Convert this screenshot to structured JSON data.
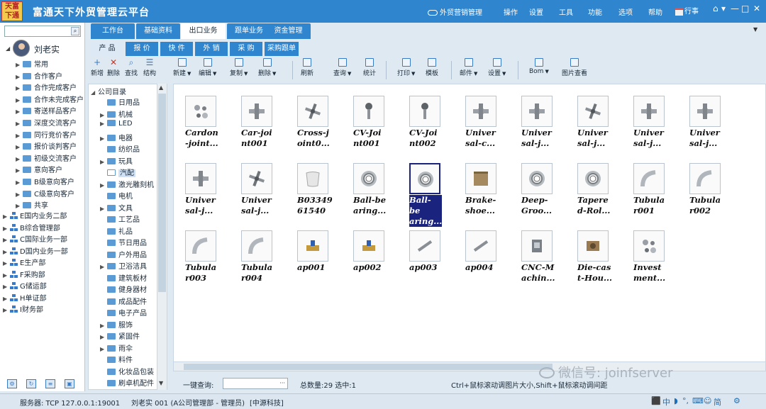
{
  "app": {
    "logo_text": "天富下通",
    "title": "富通天下外贸管理云平台",
    "cloud_menu": "外贸营销管理",
    "menu": [
      "操作",
      "设置",
      "工具",
      "功能",
      "选项",
      "帮助"
    ],
    "event_btn": "行事",
    "window_controls": [
      "⌂",
      "▾",
      "—",
      "□",
      "✕"
    ]
  },
  "user_panel": {
    "search_placeholder": "",
    "user_name": "刘老实",
    "items": [
      {
        "label": "常用",
        "kind": "folder"
      },
      {
        "label": "合作客户",
        "kind": "folder"
      },
      {
        "label": "合作完成客户",
        "kind": "folder"
      },
      {
        "label": "合作未完成客户",
        "kind": "folder"
      },
      {
        "label": "寄送样品客户",
        "kind": "folder"
      },
      {
        "label": "深度交流客户",
        "kind": "folder"
      },
      {
        "label": "同行竞价客户",
        "kind": "folder"
      },
      {
        "label": "报价谈判客户",
        "kind": "folder"
      },
      {
        "label": "初级交流客户",
        "kind": "folder"
      },
      {
        "label": "意向客户",
        "kind": "folder"
      },
      {
        "label": "B级意向客户",
        "kind": "folder"
      },
      {
        "label": "C级意向客户",
        "kind": "folder"
      },
      {
        "label": "共享",
        "kind": "folder"
      }
    ],
    "departments": [
      "E国内业务二部",
      "B综合管理部",
      "C国际业务一部",
      "D国内业务一部",
      "E生产部",
      "F采购部",
      "G储运部",
      "H单证部",
      "I财务部"
    ]
  },
  "main_tabs": [
    {
      "label": "工作台",
      "active": false
    },
    {
      "label": "基础资料",
      "active": false
    },
    {
      "label": "出口业务",
      "active": true
    },
    {
      "label": "跟单业务",
      "active": false
    },
    {
      "label": "资金管理",
      "active": false
    }
  ],
  "sub_tabs": [
    {
      "label": "产 品",
      "active": true
    },
    {
      "label": "报 价",
      "active": false
    },
    {
      "label": "快 件",
      "active": false
    },
    {
      "label": "外 销",
      "active": false
    },
    {
      "label": "采 购",
      "active": false
    },
    {
      "label": "采购跟单",
      "active": false
    }
  ],
  "left_toolbar": [
    {
      "label": "新增",
      "icon": "plus-icon"
    },
    {
      "label": "删除",
      "icon": "x-icon"
    },
    {
      "label": "查找",
      "icon": "find-icon"
    },
    {
      "label": "结构",
      "icon": "structure-icon"
    }
  ],
  "catalog": {
    "root": "公司目录",
    "items": [
      {
        "label": "日用品",
        "expandable": false
      },
      {
        "label": "机械",
        "expandable": true
      },
      {
        "label": "LED",
        "expandable": true
      },
      {
        "label": "电器",
        "expandable": true
      },
      {
        "label": "纺织品",
        "expandable": false
      },
      {
        "label": "玩具",
        "expandable": true
      },
      {
        "label": "汽配",
        "expandable": false,
        "selected": true
      },
      {
        "label": "激光雕刻机",
        "expandable": true
      },
      {
        "label": "电机",
        "expandable": false
      },
      {
        "label": "文具",
        "expandable": true
      },
      {
        "label": "工艺品",
        "expandable": false
      },
      {
        "label": "礼品",
        "expandable": false
      },
      {
        "label": "节日用品",
        "expandable": false
      },
      {
        "label": "户外用品",
        "expandable": false
      },
      {
        "label": "卫浴洁具",
        "expandable": true
      },
      {
        "label": "建筑板材",
        "expandable": false
      },
      {
        "label": "健身器材",
        "expandable": false
      },
      {
        "label": "成品配件",
        "expandable": false
      },
      {
        "label": "电子产品",
        "expandable": false
      },
      {
        "label": "服饰",
        "expandable": true
      },
      {
        "label": "紧固件",
        "expandable": true
      },
      {
        "label": "雨伞",
        "expandable": true
      },
      {
        "label": "料件",
        "expandable": false
      },
      {
        "label": "化妆品包装",
        "expandable": false
      },
      {
        "label": "刷卓机配件",
        "expandable": false
      }
    ]
  },
  "main_toolbar": [
    {
      "label": "新建",
      "dropdown": true
    },
    {
      "label": "编辑",
      "dropdown": true
    },
    {
      "label": "复制",
      "dropdown": true
    },
    {
      "label": "删除",
      "dropdown": true
    },
    {
      "label": "刷新",
      "dropdown": false
    },
    {
      "label": "查询",
      "dropdown": true
    },
    {
      "label": "统计",
      "dropdown": false
    },
    {
      "label": "打印",
      "dropdown": true
    },
    {
      "label": "模板",
      "dropdown": false
    },
    {
      "label": "邮件",
      "dropdown": true
    },
    {
      "label": "设置",
      "dropdown": true
    },
    {
      "label": "Bom",
      "dropdown": true
    },
    {
      "label": "图片查看",
      "dropdown": false
    }
  ],
  "products": [
    {
      "name": [
        "Cardon",
        "-joint..."
      ],
      "icon": "parts-icon",
      "selected": false
    },
    {
      "name": [
        "Car-joi",
        "nt001"
      ],
      "icon": "ujoint-icon",
      "selected": false
    },
    {
      "name": [
        "Cross-j",
        "oint0..."
      ],
      "icon": "cross-icon",
      "selected": false
    },
    {
      "name": [
        "CV-Joi",
        "nt001"
      ],
      "icon": "cvjoint-icon",
      "selected": false
    },
    {
      "name": [
        "CV-Joi",
        "nt002"
      ],
      "icon": "cvjoint-icon",
      "selected": false
    },
    {
      "name": [
        "Univer",
        "sal-c..."
      ],
      "icon": "ujoint-icon",
      "selected": false
    },
    {
      "name": [
        "Univer",
        "sal-j..."
      ],
      "icon": "ujoint-icon",
      "selected": false
    },
    {
      "name": [
        "Univer",
        "sal-j..."
      ],
      "icon": "cross-icon",
      "selected": false
    },
    {
      "name": [
        "Univer",
        "sal-j..."
      ],
      "icon": "ujoint-icon",
      "selected": false
    },
    {
      "name": [
        "Univer",
        "sal-j..."
      ],
      "icon": "ujoint-icon",
      "selected": false
    },
    {
      "name": [
        "Univer",
        "sal-j..."
      ],
      "icon": "ujoint-icon",
      "selected": false
    },
    {
      "name": [
        "Univer",
        "sal-j..."
      ],
      "icon": "cross-icon",
      "selected": false
    },
    {
      "name": [
        "B03349",
        "61540"
      ],
      "icon": "shell-icon",
      "selected": false
    },
    {
      "name": [
        "Ball-be",
        "aring..."
      ],
      "icon": "bearing-icon",
      "selected": false
    },
    {
      "name": [
        "Ball-be",
        "aring..."
      ],
      "icon": "bearing-icon",
      "selected": true
    },
    {
      "name": [
        "Brake-",
        "shoe..."
      ],
      "icon": "brake-icon",
      "selected": false
    },
    {
      "name": [
        "Deep-",
        "Groo..."
      ],
      "icon": "bearing-icon",
      "selected": false
    },
    {
      "name": [
        "Tapere",
        "d-Rol..."
      ],
      "icon": "bearing-icon",
      "selected": false
    },
    {
      "name": [
        "Tubula",
        "r001"
      ],
      "icon": "tube-icon",
      "selected": false
    },
    {
      "name": [
        "Tubula",
        "r002"
      ],
      "icon": "tube-icon",
      "selected": false
    },
    {
      "name": [
        "Tubula",
        "r003"
      ],
      "icon": "tube-icon",
      "selected": false
    },
    {
      "name": [
        "Tubula",
        "r004"
      ],
      "icon": "tube-icon",
      "selected": false
    },
    {
      "name": [
        "ap001"
      ],
      "icon": "valve-icon",
      "selected": false
    },
    {
      "name": [
        "ap002"
      ],
      "icon": "valve-icon",
      "selected": false
    },
    {
      "name": [
        "ap003"
      ],
      "icon": "rod-icon",
      "selected": false
    },
    {
      "name": [
        "ap004"
      ],
      "icon": "rod-icon",
      "selected": false
    },
    {
      "name": [
        "CNC-M",
        "achin..."
      ],
      "icon": "cnc-icon",
      "selected": false
    },
    {
      "name": [
        "Die-cas",
        "t-Hou..."
      ],
      "icon": "housing-icon",
      "selected": false
    },
    {
      "name": [
        "Invest",
        "ment..."
      ],
      "icon": "parts-icon",
      "selected": false
    }
  ],
  "bottom": {
    "query_label": "一键查询:",
    "query_value": "",
    "query_btn": "···",
    "count_text": "总数量:29 选中:1",
    "hint": "Ctrl+鼠标滚动调图片大小,Shift+鼠标滚动调间距",
    "watermark": "微信号: joinfserver"
  },
  "status": {
    "server": "服务器: TCP  127.0.0.1:19001",
    "user": "刘老实 001 (A公司管理部 - 管理员)",
    "company": "[中源科技]"
  },
  "ime": {
    "items": [
      "中",
      "◗",
      "°,",
      "⌨",
      "☺",
      "简",
      "⚙"
    ]
  },
  "colors": {
    "titlebar": "#2f86cf",
    "selected": "#1a237e",
    "folder": "#5b9bd5"
  }
}
